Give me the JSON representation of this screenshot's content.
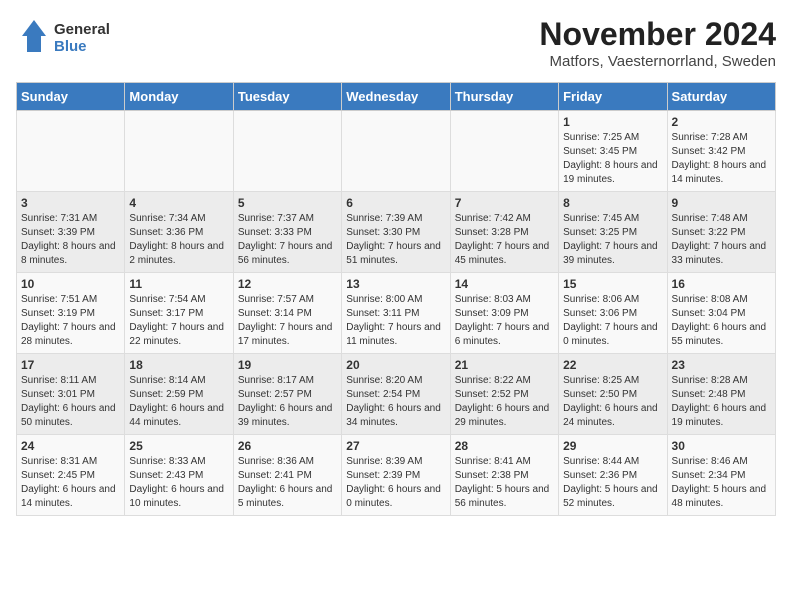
{
  "logo": {
    "general": "General",
    "blue": "Blue"
  },
  "title": "November 2024",
  "subtitle": "Matfors, Vaesternorrland, Sweden",
  "days_of_week": [
    "Sunday",
    "Monday",
    "Tuesday",
    "Wednesday",
    "Thursday",
    "Friday",
    "Saturday"
  ],
  "weeks": [
    [
      {
        "day": "",
        "info": ""
      },
      {
        "day": "",
        "info": ""
      },
      {
        "day": "",
        "info": ""
      },
      {
        "day": "",
        "info": ""
      },
      {
        "day": "",
        "info": ""
      },
      {
        "day": "1",
        "info": "Sunrise: 7:25 AM\nSunset: 3:45 PM\nDaylight: 8 hours and 19 minutes."
      },
      {
        "day": "2",
        "info": "Sunrise: 7:28 AM\nSunset: 3:42 PM\nDaylight: 8 hours and 14 minutes."
      }
    ],
    [
      {
        "day": "3",
        "info": "Sunrise: 7:31 AM\nSunset: 3:39 PM\nDaylight: 8 hours and 8 minutes."
      },
      {
        "day": "4",
        "info": "Sunrise: 7:34 AM\nSunset: 3:36 PM\nDaylight: 8 hours and 2 minutes."
      },
      {
        "day": "5",
        "info": "Sunrise: 7:37 AM\nSunset: 3:33 PM\nDaylight: 7 hours and 56 minutes."
      },
      {
        "day": "6",
        "info": "Sunrise: 7:39 AM\nSunset: 3:30 PM\nDaylight: 7 hours and 51 minutes."
      },
      {
        "day": "7",
        "info": "Sunrise: 7:42 AM\nSunset: 3:28 PM\nDaylight: 7 hours and 45 minutes."
      },
      {
        "day": "8",
        "info": "Sunrise: 7:45 AM\nSunset: 3:25 PM\nDaylight: 7 hours and 39 minutes."
      },
      {
        "day": "9",
        "info": "Sunrise: 7:48 AM\nSunset: 3:22 PM\nDaylight: 7 hours and 33 minutes."
      }
    ],
    [
      {
        "day": "10",
        "info": "Sunrise: 7:51 AM\nSunset: 3:19 PM\nDaylight: 7 hours and 28 minutes."
      },
      {
        "day": "11",
        "info": "Sunrise: 7:54 AM\nSunset: 3:17 PM\nDaylight: 7 hours and 22 minutes."
      },
      {
        "day": "12",
        "info": "Sunrise: 7:57 AM\nSunset: 3:14 PM\nDaylight: 7 hours and 17 minutes."
      },
      {
        "day": "13",
        "info": "Sunrise: 8:00 AM\nSunset: 3:11 PM\nDaylight: 7 hours and 11 minutes."
      },
      {
        "day": "14",
        "info": "Sunrise: 8:03 AM\nSunset: 3:09 PM\nDaylight: 7 hours and 6 minutes."
      },
      {
        "day": "15",
        "info": "Sunrise: 8:06 AM\nSunset: 3:06 PM\nDaylight: 7 hours and 0 minutes."
      },
      {
        "day": "16",
        "info": "Sunrise: 8:08 AM\nSunset: 3:04 PM\nDaylight: 6 hours and 55 minutes."
      }
    ],
    [
      {
        "day": "17",
        "info": "Sunrise: 8:11 AM\nSunset: 3:01 PM\nDaylight: 6 hours and 50 minutes."
      },
      {
        "day": "18",
        "info": "Sunrise: 8:14 AM\nSunset: 2:59 PM\nDaylight: 6 hours and 44 minutes."
      },
      {
        "day": "19",
        "info": "Sunrise: 8:17 AM\nSunset: 2:57 PM\nDaylight: 6 hours and 39 minutes."
      },
      {
        "day": "20",
        "info": "Sunrise: 8:20 AM\nSunset: 2:54 PM\nDaylight: 6 hours and 34 minutes."
      },
      {
        "day": "21",
        "info": "Sunrise: 8:22 AM\nSunset: 2:52 PM\nDaylight: 6 hours and 29 minutes."
      },
      {
        "day": "22",
        "info": "Sunrise: 8:25 AM\nSunset: 2:50 PM\nDaylight: 6 hours and 24 minutes."
      },
      {
        "day": "23",
        "info": "Sunrise: 8:28 AM\nSunset: 2:48 PM\nDaylight: 6 hours and 19 minutes."
      }
    ],
    [
      {
        "day": "24",
        "info": "Sunrise: 8:31 AM\nSunset: 2:45 PM\nDaylight: 6 hours and 14 minutes."
      },
      {
        "day": "25",
        "info": "Sunrise: 8:33 AM\nSunset: 2:43 PM\nDaylight: 6 hours and 10 minutes."
      },
      {
        "day": "26",
        "info": "Sunrise: 8:36 AM\nSunset: 2:41 PM\nDaylight: 6 hours and 5 minutes."
      },
      {
        "day": "27",
        "info": "Sunrise: 8:39 AM\nSunset: 2:39 PM\nDaylight: 6 hours and 0 minutes."
      },
      {
        "day": "28",
        "info": "Sunrise: 8:41 AM\nSunset: 2:38 PM\nDaylight: 5 hours and 56 minutes."
      },
      {
        "day": "29",
        "info": "Sunrise: 8:44 AM\nSunset: 2:36 PM\nDaylight: 5 hours and 52 minutes."
      },
      {
        "day": "30",
        "info": "Sunrise: 8:46 AM\nSunset: 2:34 PM\nDaylight: 5 hours and 48 minutes."
      }
    ]
  ]
}
